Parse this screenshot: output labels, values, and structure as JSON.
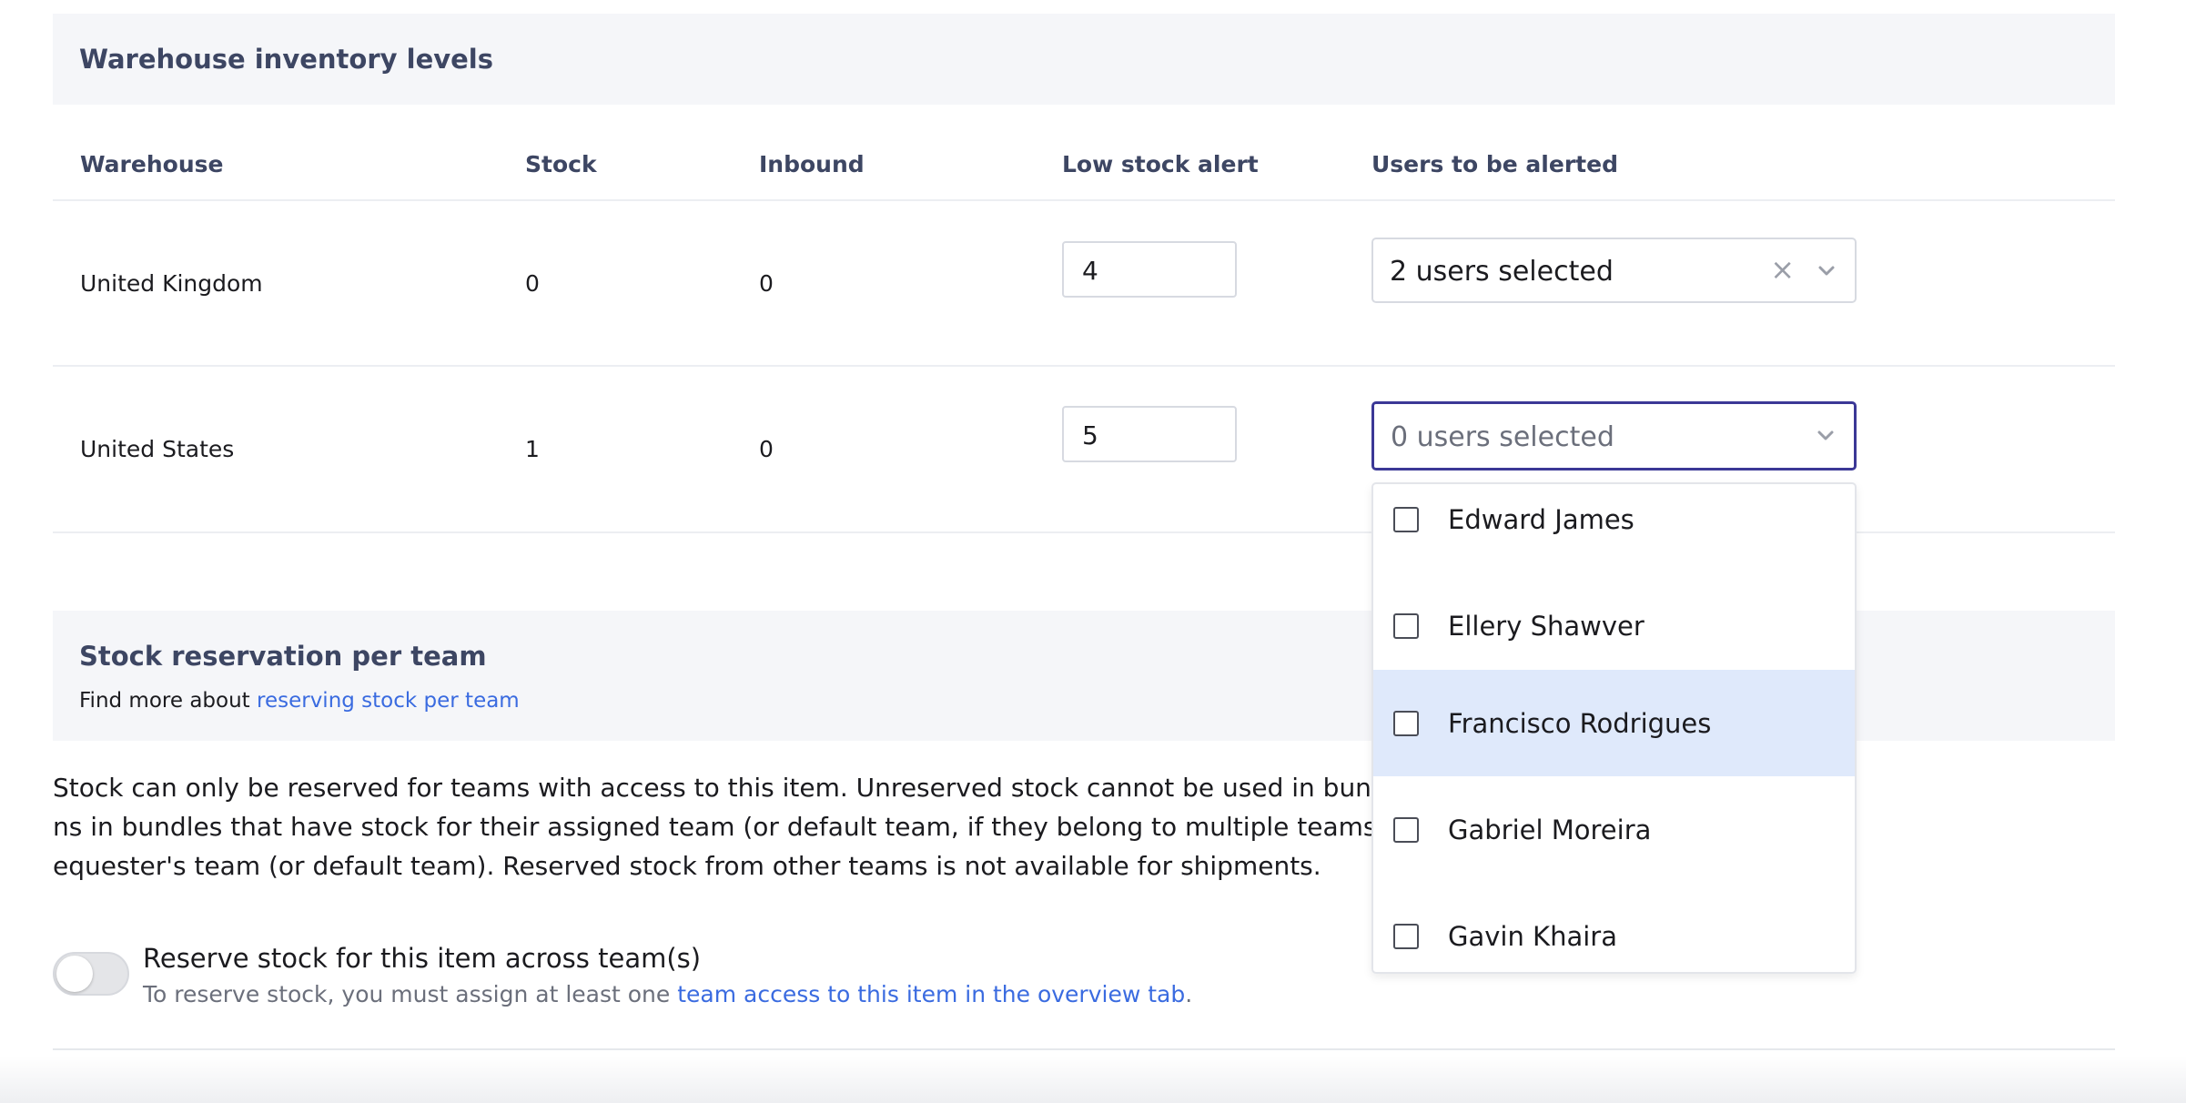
{
  "inventory": {
    "title": "Warehouse inventory levels",
    "columns": [
      "Warehouse",
      "Stock",
      "Inbound",
      "Low stock alert",
      "Users to be alerted"
    ],
    "rows": [
      {
        "warehouse": "United Kingdom",
        "stock": "0",
        "inbound": "0",
        "low_stock_alert": "4",
        "users_selected": "2 users selected"
      },
      {
        "warehouse": "United States",
        "stock": "1",
        "inbound": "0",
        "low_stock_alert": "5",
        "users_selected": "0 users selected"
      }
    ],
    "clear_icon": "×",
    "dropdown_options": [
      {
        "name": "Edward James",
        "checked": false
      },
      {
        "name": "Ellery Shawver",
        "checked": false
      },
      {
        "name": "Francisco Rodrigues",
        "checked": false,
        "highlighted": true
      },
      {
        "name": "Gabriel Moreira",
        "checked": false
      },
      {
        "name": "Gavin Khaira",
        "checked": false
      }
    ]
  },
  "reservation": {
    "title": "Stock reservation per team",
    "find_more_prefix": "Find more about ",
    "find_more_link": "reserving stock per team",
    "description_part1": "Stock can only be reserved for teams with access to this item. Unreserved stock cannot be used in bundle send",
    "description_part2": "ns in bundles that have stock for their assigned team (or default team, if they belong to multiple teams). Stock shipments pull fron",
    "description_part3": "equester's team (or default team). Reserved stock from other teams is not available for shipments.",
    "toggle_label": "Reserve stock for this item across team(s)",
    "toggle_on": false,
    "help_prefix": "To reserve stock, you must assign at least one ",
    "help_link": "team access to this item in the overview tab",
    "help_suffix": "."
  },
  "colors": {
    "heading": "#3d4663",
    "link": "#3a6be0",
    "focus_border": "#3b3896",
    "highlight": "#dfe9fb",
    "band": "#f5f6f9"
  }
}
